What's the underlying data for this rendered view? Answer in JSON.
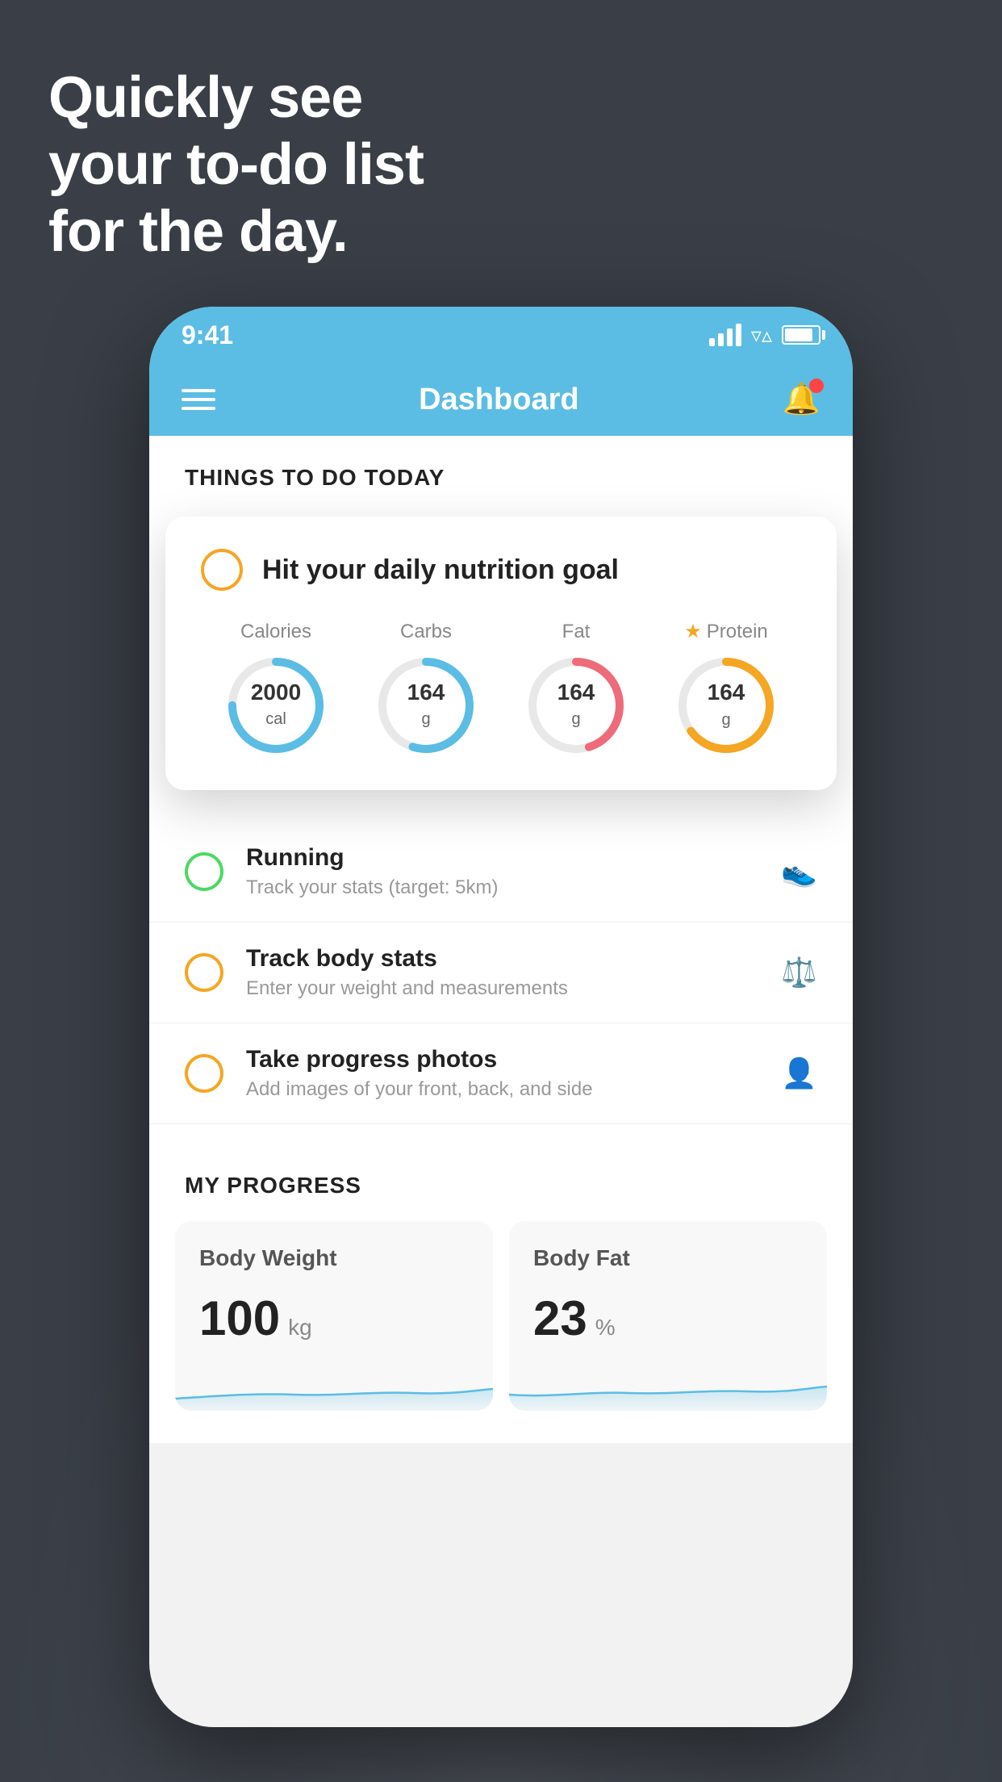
{
  "hero": {
    "line1": "Quickly see",
    "line2": "your to-do list",
    "line3": "for the day."
  },
  "status_bar": {
    "time": "9:41"
  },
  "nav": {
    "title": "Dashboard"
  },
  "things_section": {
    "header": "THINGS TO DO TODAY"
  },
  "floating_card": {
    "title": "Hit your daily nutrition goal",
    "nutrients": [
      {
        "label": "Calories",
        "value": "2000",
        "unit": "cal",
        "color": "#5bbde4",
        "track": 75
      },
      {
        "label": "Carbs",
        "value": "164",
        "unit": "g",
        "color": "#5bbde4",
        "track": 55
      },
      {
        "label": "Fat",
        "value": "164",
        "unit": "g",
        "color": "#ee6b7a",
        "track": 45
      },
      {
        "label": "Protein",
        "value": "164",
        "unit": "g",
        "color": "#f5a623",
        "track": 65,
        "starred": true
      }
    ]
  },
  "todo_items": [
    {
      "title": "Running",
      "subtitle": "Track your stats (target: 5km)",
      "circle_color": "green",
      "icon": "👟"
    },
    {
      "title": "Track body stats",
      "subtitle": "Enter your weight and measurements",
      "circle_color": "yellow",
      "icon": "⚖️"
    },
    {
      "title": "Take progress photos",
      "subtitle": "Add images of your front, back, and side",
      "circle_color": "yellow",
      "icon": "👤"
    }
  ],
  "progress_section": {
    "header": "MY PROGRESS",
    "cards": [
      {
        "title": "Body Weight",
        "value": "100",
        "unit": "kg"
      },
      {
        "title": "Body Fat",
        "value": "23",
        "unit": "%"
      }
    ]
  }
}
